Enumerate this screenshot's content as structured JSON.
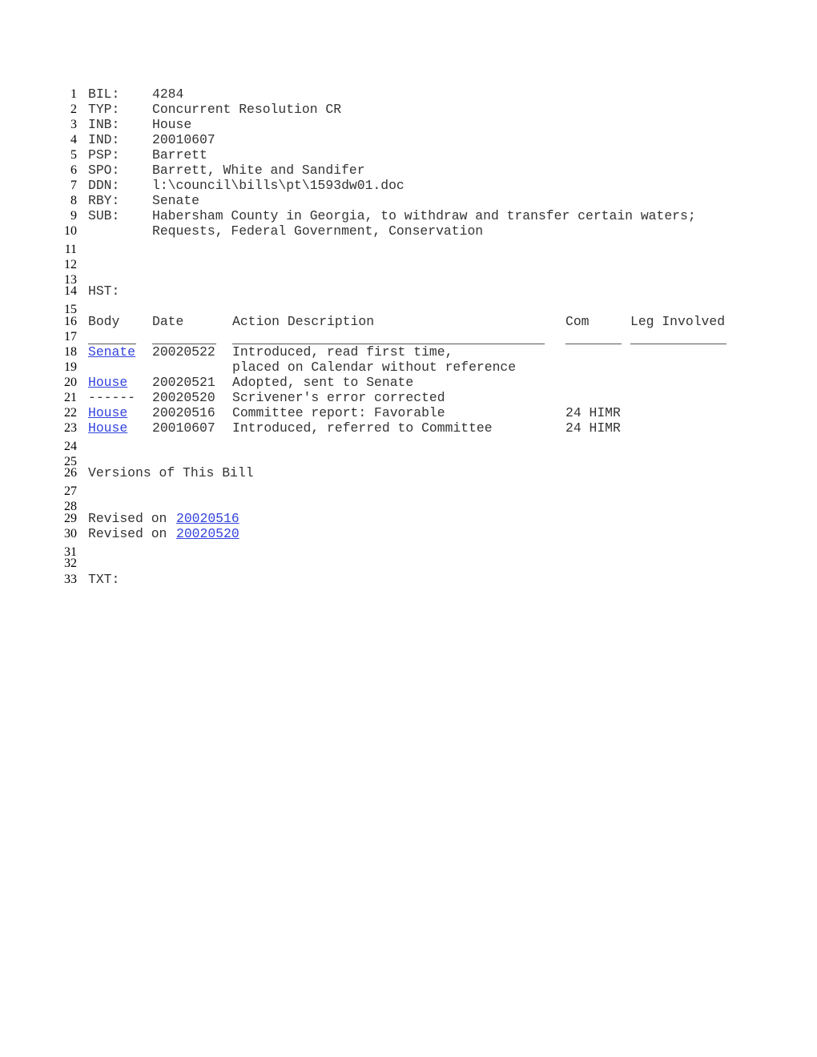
{
  "header": {
    "fields": [
      {
        "line": "1",
        "key": "BIL:",
        "value": "4284"
      },
      {
        "line": "2",
        "key": "TYP:",
        "value": "Concurrent Resolution CR"
      },
      {
        "line": "3",
        "key": "INB:",
        "value": "House"
      },
      {
        "line": "4",
        "key": "IND:",
        "value": "20010607"
      },
      {
        "line": "5",
        "key": "PSP:",
        "value": "Barrett"
      },
      {
        "line": "6",
        "key": "SPO:",
        "value": "Barrett, White and Sandifer"
      },
      {
        "line": "7",
        "key": "DDN:",
        "value": "l:\\council\\bills\\pt\\1593dw01.doc"
      },
      {
        "line": "8",
        "key": "RBY:",
        "value": "Senate"
      },
      {
        "line": "9",
        "key": "SUB:",
        "value": "Habersham County in Georgia, to withdraw and transfer certain waters;"
      },
      {
        "line": "10",
        "key": "",
        "value": "Requests, Federal Government, Conservation"
      }
    ]
  },
  "blank_lines": [
    "11",
    "12",
    "13",
    "15",
    "17",
    "24",
    "25",
    "27",
    "28",
    "31",
    "32"
  ],
  "history": {
    "label_line": "14",
    "label": "HST:",
    "header_line": "16",
    "columns": {
      "body": "Body",
      "date": "Date",
      "action": "Action Description",
      "com": "Com",
      "leg": "Leg Involved"
    },
    "rows": [
      {
        "line": "18",
        "body": "Senate",
        "body_link": true,
        "date": "20020522",
        "action": "Introduced, read first time,",
        "com": "",
        "leg": ""
      },
      {
        "line": "19",
        "body": "",
        "body_link": false,
        "date": "",
        "action": "placed on Calendar without reference",
        "com": "",
        "leg": ""
      },
      {
        "line": "20",
        "body": "House",
        "body_link": true,
        "date": "20020521",
        "action": "Adopted, sent to Senate",
        "com": "",
        "leg": ""
      },
      {
        "line": "21",
        "body": "------",
        "body_link": false,
        "date": "20020520",
        "action": "Scrivener's error corrected",
        "com": "",
        "leg": ""
      },
      {
        "line": "22",
        "body": "House",
        "body_link": true,
        "date": "20020516",
        "action": "Committee report: Favorable",
        "com": "24 HIMR",
        "leg": ""
      },
      {
        "line": "23",
        "body": "House",
        "body_link": true,
        "date": "20010607",
        "action": "Introduced, referred to Committee",
        "com": "24 HIMR",
        "leg": ""
      }
    ]
  },
  "versions": {
    "title_line": "26",
    "title": "Versions of This Bill",
    "items": [
      {
        "line": "29",
        "prefix": "Revised on",
        "date": "20020516"
      },
      {
        "line": "30",
        "prefix": "Revised on",
        "date": "20020520"
      }
    ]
  },
  "text_section": {
    "line": "33",
    "label": "TXT:"
  },
  "colors": {
    "link": "#3344dd",
    "text": "#333333"
  }
}
